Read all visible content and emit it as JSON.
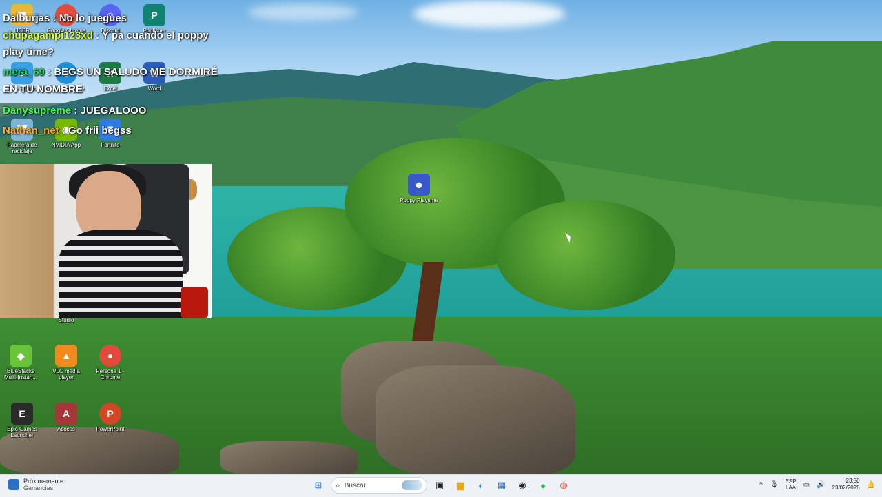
{
  "chat": [
    {
      "user": "Dalburjas",
      "user_color": "#ffffff",
      "sep": " : ",
      "msg": "No lo juegues"
    },
    {
      "user": "chupagampi123xd",
      "user_color": "#d8ff3b",
      "sep": " : ",
      "msg": "Y pa cuando el poppy play time?"
    },
    {
      "user": "mera_69",
      "user_color": "#2fd36b",
      "sep": " : ",
      "msg": "BEGS UN SALUDO ME DORMIRÉ EN TU NOMBRE"
    },
    {
      "user": "Danysupreme",
      "user_color": "#3bff4f",
      "sep": " : ",
      "msg": "JUEGALOOO"
    },
    {
      "user": "Nathan_net",
      "user_color": "#ffae1f",
      "sep": " : ",
      "msg": "Go frii begss"
    }
  ],
  "desktop_icons": {
    "user": {
      "label": "USER",
      "icon": "folder-icon",
      "color": "#e9b83a"
    },
    "chrome": {
      "label": "Google Chrome",
      "icon": "chrome-icon",
      "color": "#e04b3c"
    },
    "discord": {
      "label": "Discord",
      "icon": "discord-icon",
      "color": "#5865f2"
    },
    "publisher": {
      "label": "Publisher",
      "icon": "publisher-icon",
      "color": "#108272"
    },
    "este_equipo": {
      "label": "Este equipo",
      "icon": "computer-icon",
      "color": "#3aa0e6"
    },
    "edge": {
      "label": "Microsoft Edge",
      "icon": "edge-icon",
      "color": "#1d8fd6"
    },
    "excel": {
      "label": "Excel",
      "icon": "excel-icon",
      "color": "#1d7a45"
    },
    "word": {
      "label": "Word",
      "icon": "word-icon",
      "color": "#2b5cb8"
    },
    "recycle": {
      "label": "Papelera de reciclaje",
      "icon": "recycle-bin-icon",
      "color": "#7fb3d8"
    },
    "nvidia": {
      "label": "NVIDIA App",
      "icon": "nvidia-icon",
      "color": "#76b900"
    },
    "fortnite": {
      "label": "Fortnite",
      "icon": "fortnite-icon",
      "color": "#2f7be0"
    },
    "poppy": {
      "label": "Poppy Playtime",
      "icon": "poppy-playtime-icon",
      "color": "#3a59c9"
    },
    "studio": {
      "label": "Studio",
      "icon": "studio-icon",
      "color": "#444444"
    },
    "bluestacks": {
      "label": "BlueStacks Multi-Instan...",
      "icon": "bluestacks-icon",
      "color": "#6ac43a"
    },
    "vlc": {
      "label": "VLC media player",
      "icon": "vlc-icon",
      "color": "#f08a1c"
    },
    "persona1": {
      "label": "Persona 1 - Chrome",
      "icon": "chrome-icon",
      "color": "#e04b3c"
    },
    "epic": {
      "label": "Epic Games Launcher",
      "icon": "epic-games-icon",
      "color": "#2a2a2a"
    },
    "access": {
      "label": "Access",
      "icon": "access-icon",
      "color": "#a4373a"
    },
    "powerpoint": {
      "label": "PowerPoint",
      "icon": "powerpoint-icon",
      "color": "#d24726"
    }
  },
  "taskbar": {
    "weather_title": "Próximamente",
    "weather_sub": "Ganancias",
    "search_placeholder": "Buscar",
    "lang_top": "ESP",
    "lang_bottom": "LAA",
    "time": "23:50",
    "date": "23/02/2026"
  }
}
